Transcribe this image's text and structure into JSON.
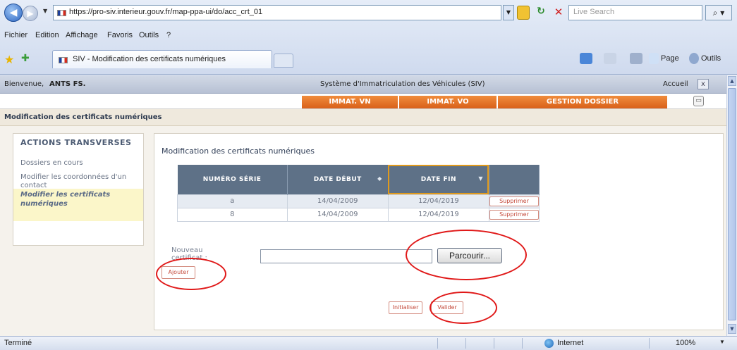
{
  "browser": {
    "url": "https://pro-siv.interieur.gouv.fr/map-ppa-ui/do/acc_crt_01",
    "search_placeholder": "Live Search",
    "menu": [
      "Fichier",
      "Edition",
      "Affichage",
      "Favoris",
      "Outils",
      "?"
    ],
    "tab_title": "SIV - Modification des certificats numériques",
    "commands": {
      "page": "Page",
      "tools": "Outils"
    },
    "status_left": "Terminé",
    "zone": "Internet",
    "zoom": "100%"
  },
  "header": {
    "welcome_prefix": "Bienvenue,",
    "user": "ANTS FS.",
    "app_title": "Système d'Immatriculation des Véhicules (SIV)",
    "home_link": "Accueil",
    "close_symbol": "x"
  },
  "menu_tabs": [
    "IMMAT. VN",
    "IMMAT. VO",
    "GESTION DOSSIER"
  ],
  "breadcrumb": "Modification des certificats numériques",
  "sidebar": {
    "heading": "ACTIONS TRANSVERSES",
    "links": [
      "Dossiers en cours",
      "Modifier les coordonnées d'un contact"
    ],
    "active": "Modifier les certificats numériques"
  },
  "main": {
    "title": "Modification des certificats numériques",
    "table": {
      "headers": [
        "NUMÉRO SÉRIE",
        "DATE DÉBUT",
        "DATE FIN",
        ""
      ],
      "rows": [
        {
          "serial": "a",
          "start": "14/04/2009",
          "end": "12/04/2019",
          "action": "Supprimer"
        },
        {
          "serial": "8",
          "start": "14/04/2009",
          "end": "12/04/2019",
          "action": "Supprimer"
        }
      ]
    },
    "new_cert_label": "Nouveau certificat :",
    "browse_label": "Parcourir...",
    "add_label": "Ajouter",
    "reset_label": "Initialiser",
    "submit_label": "Valider"
  },
  "annotation_color": "#e01818",
  "accent_color": "#e8722a"
}
